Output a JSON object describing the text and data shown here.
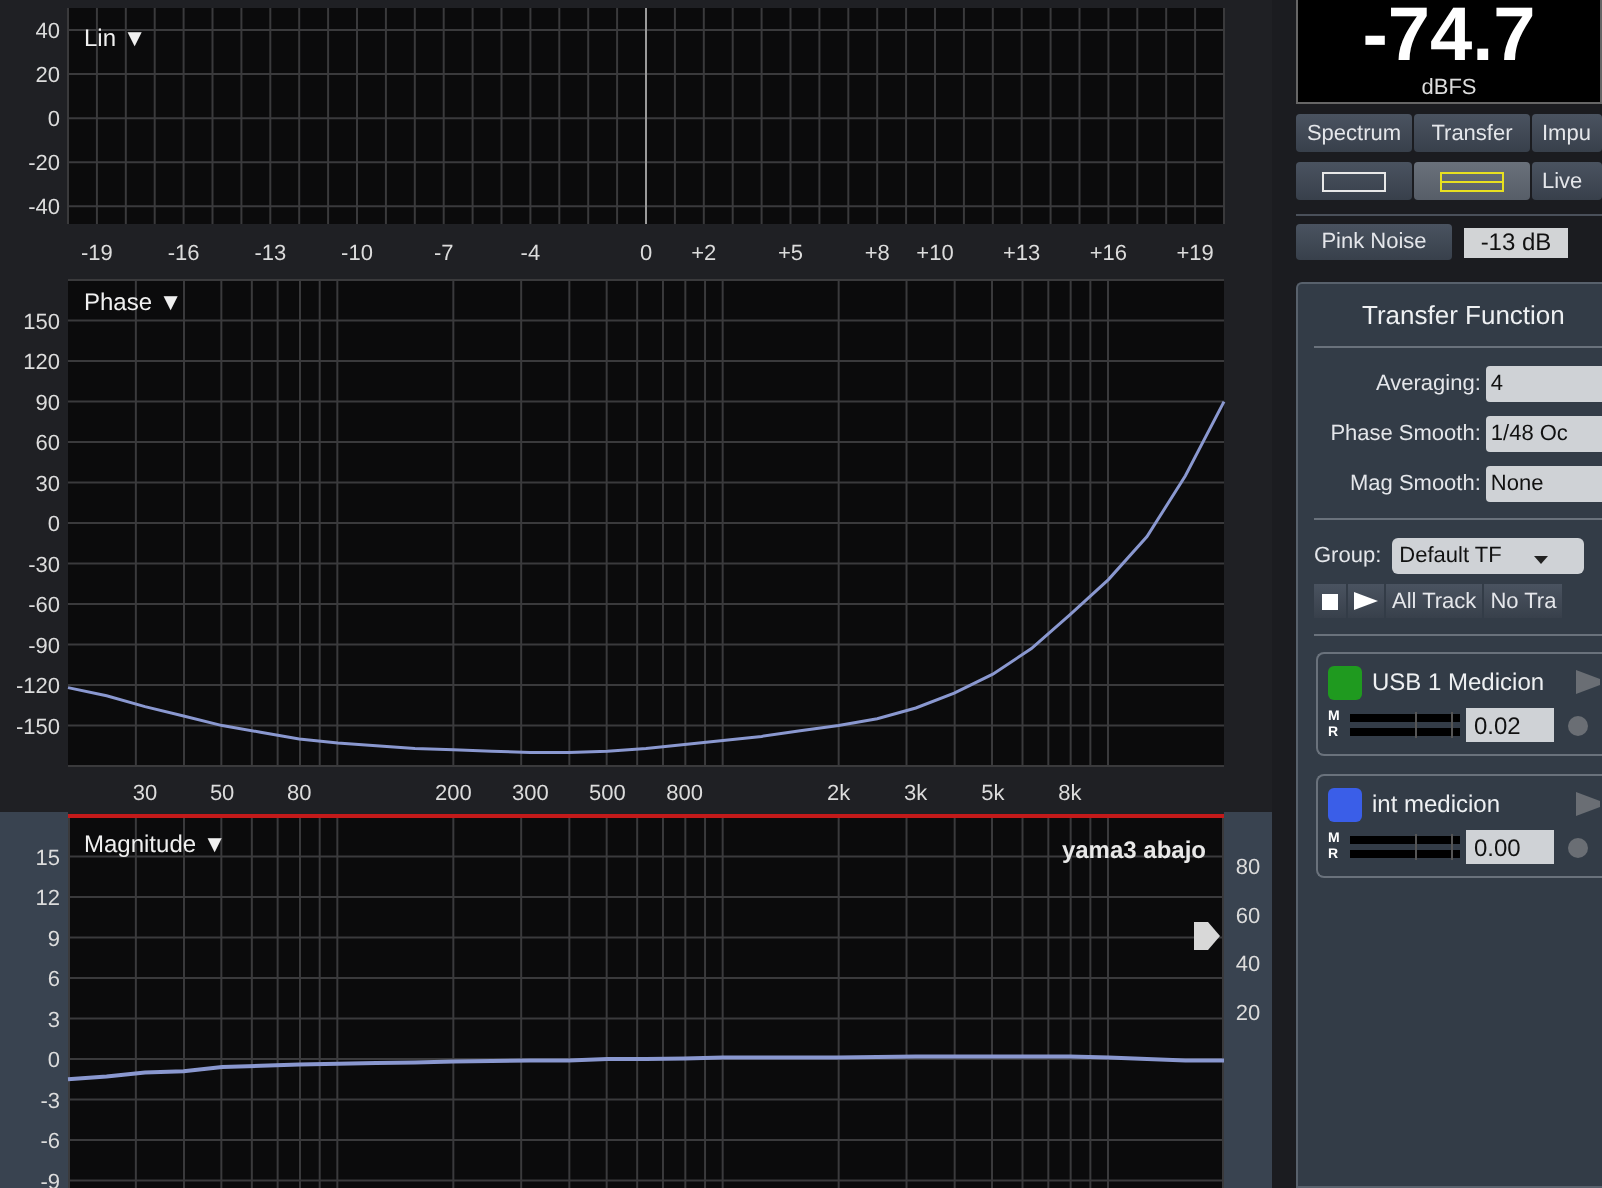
{
  "impulse_plot": {
    "label": "Lin ▼",
    "chart_data": {
      "type": "line",
      "grid": true,
      "xlim": [
        -20,
        20
      ],
      "ylim": [
        -48,
        50
      ],
      "xticks": [
        -19,
        -16,
        -13,
        -10,
        -7,
        -4,
        0,
        {
          "value": 2,
          "label": "+2"
        },
        {
          "value": 5,
          "label": "+5"
        },
        {
          "value": 8,
          "label": "+8"
        },
        {
          "value": 10,
          "label": "+10"
        },
        {
          "value": 13,
          "label": "+13"
        },
        {
          "value": 16,
          "label": "+16"
        },
        {
          "value": 19,
          "label": "+19"
        }
      ],
      "yticks": [
        40,
        20,
        0,
        -20,
        -40
      ]
    }
  },
  "phase_plot": {
    "label": "Phase ▼",
    "chart_data": {
      "type": "line",
      "grid": true,
      "ylim": [
        -180,
        180
      ],
      "categories": [
        null,
        null,
        "30",
        null,
        "50",
        null,
        "80",
        null,
        null,
        null,
        "200",
        null,
        "300",
        null,
        "500",
        null,
        "800",
        null,
        null,
        null,
        "2k",
        null,
        "3k",
        null,
        "5k",
        null,
        "8k",
        null,
        null,
        null,
        null
      ],
      "yticks": [
        150,
        120,
        90,
        60,
        30,
        0,
        -30,
        -60,
        -90,
        -120,
        -150
      ],
      "series": [
        {
          "color": "#8a98d0",
          "values": [
            -122,
            -128,
            -136,
            -143,
            -150,
            -155,
            -160,
            -163,
            -165,
            -167,
            -168,
            -169,
            -170,
            -170,
            -169,
            -167,
            -164,
            -161,
            -158,
            -154,
            -150,
            -145,
            -137,
            -126,
            -112,
            -93,
            -68,
            -42,
            -10,
            35,
            90
          ]
        }
      ]
    }
  },
  "magnitude_plot": {
    "label": "Magnitude ▼",
    "chart_data": {
      "type": "line",
      "grid": true,
      "ylim": [
        -10,
        18
      ],
      "yticks": [
        15,
        12,
        9,
        6,
        3,
        0,
        -3,
        -6,
        -9
      ],
      "series": [
        {
          "name": "yama3 abajo",
          "color": "#8a98d0",
          "values": [
            -1.5,
            -1.3,
            -1.0,
            -0.9,
            -0.6,
            -0.5,
            -0.4,
            -0.35,
            -0.3,
            -0.25,
            -0.2,
            -0.15,
            -0.1,
            -0.1,
            0,
            0,
            0.05,
            0.1,
            0.1,
            0.1,
            0.1,
            0.15,
            0.2,
            0.2,
            0.2,
            0.2,
            0.2,
            0.1,
            0,
            -0.1,
            -0.1
          ]
        }
      ]
    },
    "coherence_ticks": [
      "80",
      "60",
      "40",
      "20"
    ]
  },
  "readout": {
    "value": "-74.7",
    "unit": "dBFS"
  },
  "mode_tabs": [
    "Spectrum",
    "Transfer",
    "Impu"
  ],
  "layout_buttons": [
    {
      "kind": "single",
      "selected": false
    },
    {
      "kind": "double",
      "selected": true
    },
    {
      "kind": "text",
      "label": "Live",
      "selected": false
    }
  ],
  "generator": {
    "button": "Pink Noise",
    "gain": "-13 dB"
  },
  "transfer_function": {
    "title": "Transfer Function",
    "settings": [
      {
        "label": "Averaging:",
        "value": "4"
      },
      {
        "label": "Phase Smooth:",
        "value": "1/48 Oc"
      },
      {
        "label": "Mag Smooth:",
        "value": "None"
      }
    ],
    "group": {
      "label": "Group:",
      "value": "Default TF"
    },
    "controls": [
      {
        "kind": "stop"
      },
      {
        "kind": "play"
      },
      {
        "kind": "text",
        "label": "All Track"
      },
      {
        "kind": "text",
        "label": "No Tra"
      }
    ],
    "measurements": [
      {
        "name": "USB 1 Medicion",
        "color": "#1f9a1f",
        "meter_labels": [
          "M",
          "R"
        ],
        "delay": "0.02"
      },
      {
        "name": "int  medicion",
        "color": "#3a5ee8",
        "meter_labels": [
          "M",
          "R"
        ],
        "delay": "0.00"
      }
    ]
  }
}
